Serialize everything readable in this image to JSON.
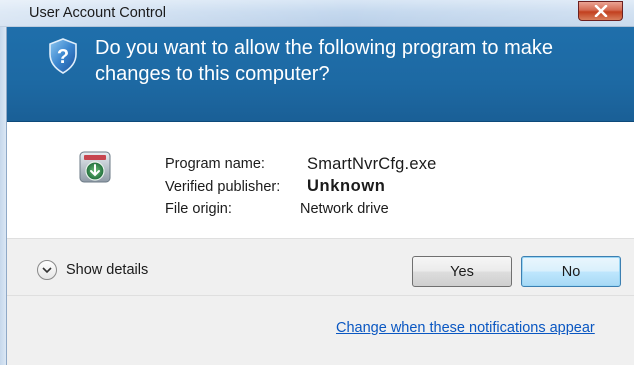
{
  "window": {
    "title": "User Account Control",
    "close_icon": "close-x-icon"
  },
  "header": {
    "question": "Do you want to allow the following program to make changes to this computer?",
    "icon": "uac-shield-icon"
  },
  "program_info": {
    "app_icon": "program-app-icon",
    "program_name_label": "Program name:",
    "program_name_value": "SmartNvrCfg.exe",
    "publisher_label": "Verified publisher:",
    "publisher_value": "Unknown",
    "origin_label": "File origin:",
    "origin_value": "Network drive"
  },
  "actions": {
    "show_details_label": "Show details",
    "show_details_icon": "chevron-down-icon",
    "yes_label": "Yes",
    "no_label": "No",
    "change_link": "Change when these notifications appear"
  },
  "colors": {
    "header_blue": "#1d69a3",
    "link_blue": "#0a57c2",
    "panel_gray": "#f0f0f0"
  }
}
